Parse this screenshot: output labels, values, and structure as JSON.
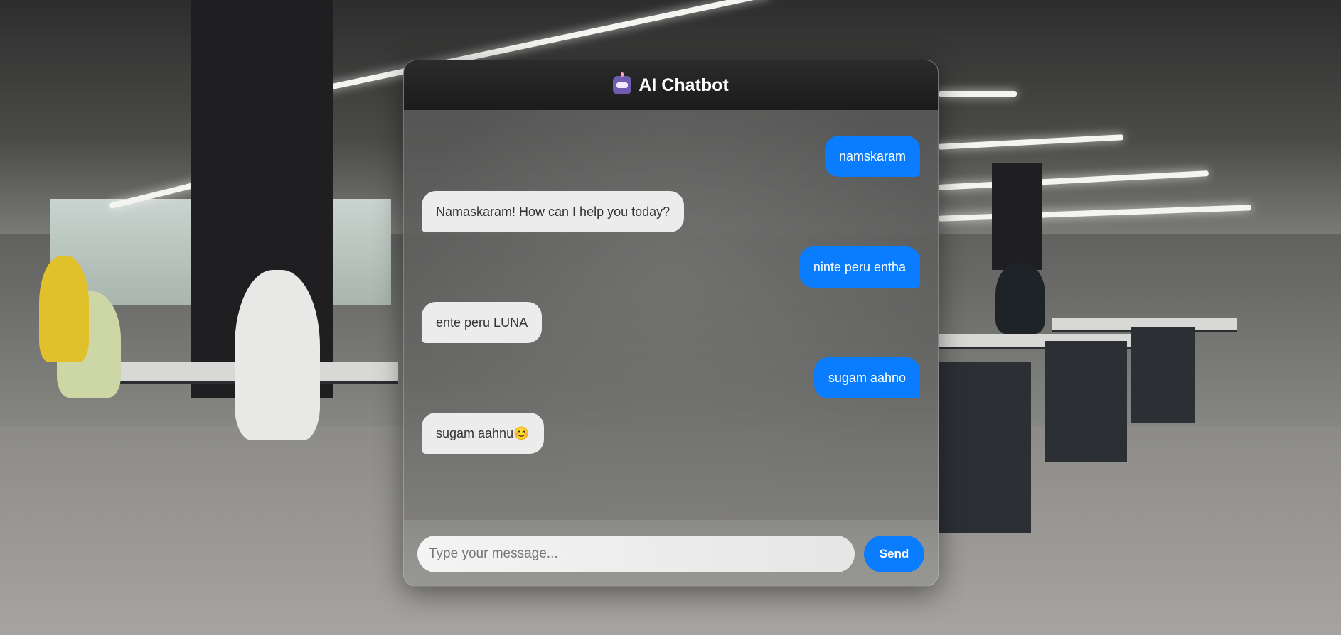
{
  "app": {
    "title": "AI Chatbot",
    "icon": "robot-icon"
  },
  "conversation": [
    {
      "role": "user",
      "text": "namskaram"
    },
    {
      "role": "bot",
      "text": "Namaskaram! How can I help you today?"
    },
    {
      "role": "user",
      "text": "ninte peru entha"
    },
    {
      "role": "bot",
      "text": "ente peru LUNA"
    },
    {
      "role": "user",
      "text": "sugam aahno"
    },
    {
      "role": "bot",
      "text": "sugam aahnu😊"
    }
  ],
  "composer": {
    "placeholder": "Type your message...",
    "value": "",
    "send_label": "Send"
  },
  "colors": {
    "user_bubble": "#0a7dff",
    "bot_bubble": "#ececec",
    "header": "#1f1f1f",
    "send_button": "#0a7dff"
  }
}
